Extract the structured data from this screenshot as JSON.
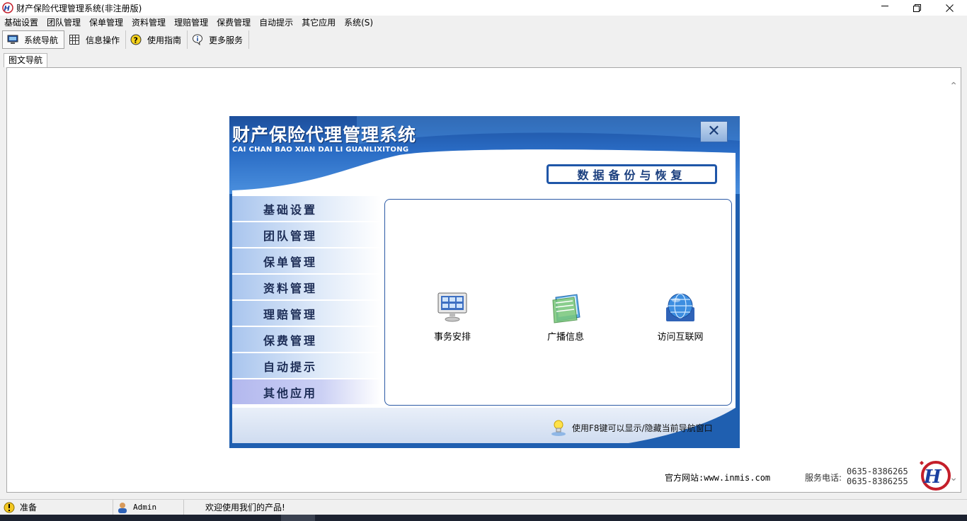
{
  "window": {
    "title": "财产保险代理管理系统(非注册版)",
    "controls": [
      "minimize",
      "maximize",
      "close"
    ]
  },
  "menubar": {
    "items": [
      "基础设置",
      "团队管理",
      "保单管理",
      "资料管理",
      "理赔管理",
      "保费管理",
      "自动提示",
      "其它应用",
      "系统(S)"
    ]
  },
  "toolbar": {
    "buttons": [
      {
        "label": "系统导航",
        "icon": "monitor-icon"
      },
      {
        "label": "信息操作",
        "icon": "grid-icon"
      },
      {
        "label": "使用指南",
        "icon": "help-icon"
      },
      {
        "label": "更多服务",
        "icon": "info-icon"
      }
    ]
  },
  "tab": {
    "label": "图文导航"
  },
  "panel": {
    "title": "财产保险代理管理系统",
    "subtitle": "CAI CHAN BAO XIAN DAI LI GUANLIXITONG",
    "backup_button": "数据备份与恢复",
    "side_menu": [
      "基础设置",
      "团队管理",
      "保单管理",
      "资料管理",
      "理赔管理",
      "保费管理",
      "自动提示",
      "其他应用"
    ],
    "active_item": "其他应用",
    "apps": [
      {
        "label": "事务安排",
        "icon": "computer-icon"
      },
      {
        "label": "广播信息",
        "icon": "notepad-icon"
      },
      {
        "label": "访问互联网",
        "icon": "globe-icon"
      }
    ],
    "hint": "使用F8键可以显示/隐藏当前导航窗口"
  },
  "footer": {
    "site": "官方网站:www.inmis.com",
    "phone_label": "服务电话:",
    "phones": [
      "0635-8386265",
      "0635-8386255"
    ]
  },
  "status": {
    "state": "准备",
    "user": "Admin",
    "message": "欢迎使用我们的产品!"
  },
  "colors": {
    "panel_blue": "#1f5fb0",
    "menu_item_light": "#dce8f8",
    "active_item": "#b3b8ee"
  }
}
